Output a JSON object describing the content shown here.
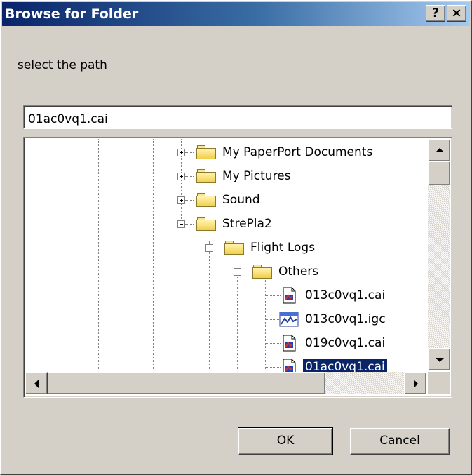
{
  "dialog": {
    "title": "Browse for Folder",
    "help_label": "?",
    "close_label": "×",
    "prompt": "select the path",
    "path_value": "01ac0vq1.cai"
  },
  "tree": {
    "items": [
      {
        "label": "My PaperPort Documents",
        "type": "folder",
        "toggle": "plus"
      },
      {
        "label": "My Pictures",
        "type": "folder",
        "toggle": "plus"
      },
      {
        "label": "Sound",
        "type": "folder",
        "toggle": "plus"
      },
      {
        "label": "StrePla2",
        "type": "folder",
        "toggle": "minus"
      },
      {
        "label": "Flight Logs",
        "type": "folder",
        "toggle": "minus"
      },
      {
        "label": "Others",
        "type": "folder",
        "toggle": "minus"
      },
      {
        "label": "013c0vq1.cai",
        "type": "cai-file"
      },
      {
        "label": "013c0vq1.igc",
        "type": "igc-file"
      },
      {
        "label": "019c0vq1.cai",
        "type": "cai-file"
      },
      {
        "label": "01ac0vq1.cai",
        "type": "cai-file",
        "selected": true
      }
    ]
  },
  "buttons": {
    "ok": "OK",
    "cancel": "Cancel"
  },
  "colors": {
    "title_start": "#0a246a",
    "title_end": "#a6caf0",
    "selection": "#0a246a",
    "face": "#d4d0c8"
  },
  "icons": {
    "folder": "folder-icon",
    "cai_file": "cai-file-icon",
    "igc_file": "igc-file-icon"
  }
}
